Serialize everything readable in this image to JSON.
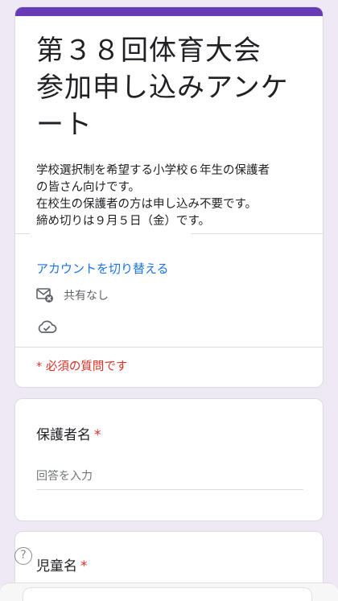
{
  "form": {
    "title_lines": [
      "第３８回体育大会",
      "参加申し込みアンケ",
      "ート"
    ],
    "description_lines": [
      "学校選択制を希望する小学校６年生の保護者",
      "の皆さん向けです。",
      "在校生の保護者の方は申し込み不要です。",
      "締め切りは９月５日（金）です。"
    ],
    "switch_account": "アカウントを切り替える",
    "share_status": "共有なし",
    "required_note": "* 必須の質問です",
    "accent_color": "#673ab7"
  },
  "questions": [
    {
      "label": "保護者名",
      "required_mark": "*",
      "placeholder": "回答を入力"
    },
    {
      "label": "児童名",
      "required_mark": "*"
    }
  ],
  "icons": {
    "share": "mail-no-share-icon",
    "cloud": "cloud-check-icon",
    "help": "help-circle-icon",
    "help_glyph": "?"
  }
}
